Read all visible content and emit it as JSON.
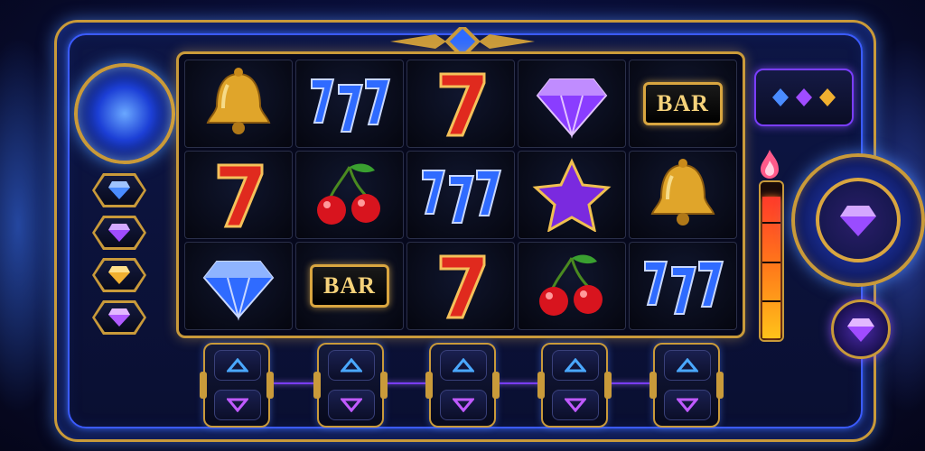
{
  "game": {
    "grid": [
      [
        "bell",
        "triple-seven-blue",
        "seven-red",
        "diamond-purple",
        "bar"
      ],
      [
        "seven-red",
        "cherries",
        "triple-seven-blue",
        "star-purple",
        "bell"
      ],
      [
        "diamond-blue",
        "bar",
        "seven-red",
        "cherries",
        "triple-seven-blue"
      ]
    ],
    "bar_label": "BAR",
    "left_gems": [
      "gem-blue",
      "gem-purple",
      "gem-gold",
      "gem-violet"
    ],
    "right_gems": [
      "gem-blue",
      "gem-purple",
      "gem-gold"
    ],
    "power_level": 0.92
  },
  "colors": {
    "frame_gold": "#c99a3a",
    "neon_blue": "#3b5bff",
    "neon_purple": "#7a3dff",
    "seven_red": "#e02a1e",
    "seven_blue": "#2f6bff"
  },
  "icons": {
    "spin_dial": "spin-dial-icon",
    "orb": "energy-orb-icon",
    "reel_up": "arrow-up-icon",
    "reel_down": "arrow-down-icon"
  }
}
